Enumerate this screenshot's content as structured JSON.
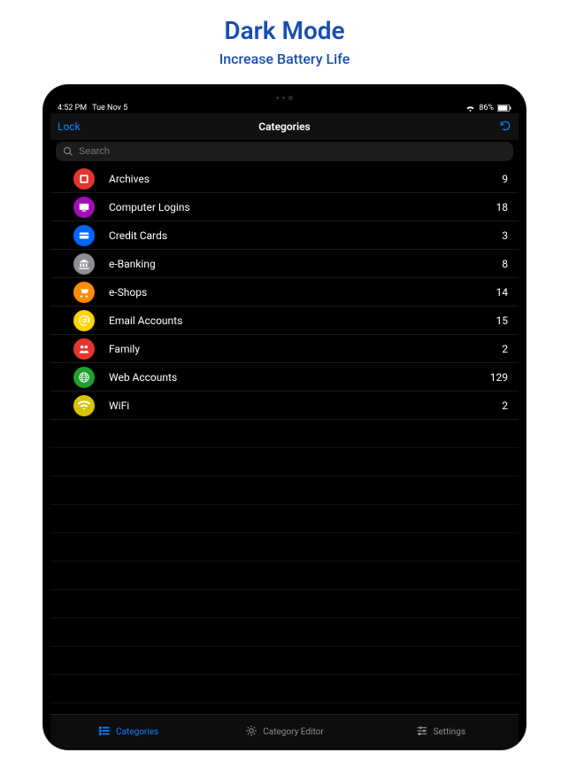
{
  "promo": {
    "title": "Dark Mode",
    "subtitle": "Increase Battery Life"
  },
  "status": {
    "time": "4:52 PM",
    "date": "Tue Nov 5",
    "battery_percent": "86%"
  },
  "nav": {
    "left_label": "Lock",
    "title": "Categories"
  },
  "search": {
    "placeholder": "Search"
  },
  "categories": [
    {
      "icon": "archive",
      "color": "#e5352f",
      "label": "Archives",
      "count": "9"
    },
    {
      "icon": "computer",
      "color": "#a30db6",
      "label": "Computer Logins",
      "count": "18"
    },
    {
      "icon": "card",
      "color": "#0066ff",
      "label": "Credit Cards",
      "count": "3"
    },
    {
      "icon": "bank",
      "color": "#8e8e93",
      "label": "e-Banking",
      "count": "8"
    },
    {
      "icon": "cart",
      "color": "#ff8c00",
      "label": "e-Shops",
      "count": "14"
    },
    {
      "icon": "at",
      "color": "#ffd400",
      "label": "Email Accounts",
      "count": "15"
    },
    {
      "icon": "family",
      "color": "#e5352f",
      "label": "Family",
      "count": "2"
    },
    {
      "icon": "globe",
      "color": "#1fa030",
      "label": "Web Accounts",
      "count": "129"
    },
    {
      "icon": "wifi",
      "color": "#d6c500",
      "label": "WiFi",
      "count": "2"
    }
  ],
  "tabs": {
    "categories": "Categories",
    "editor": "Category Editor",
    "settings": "Settings"
  }
}
